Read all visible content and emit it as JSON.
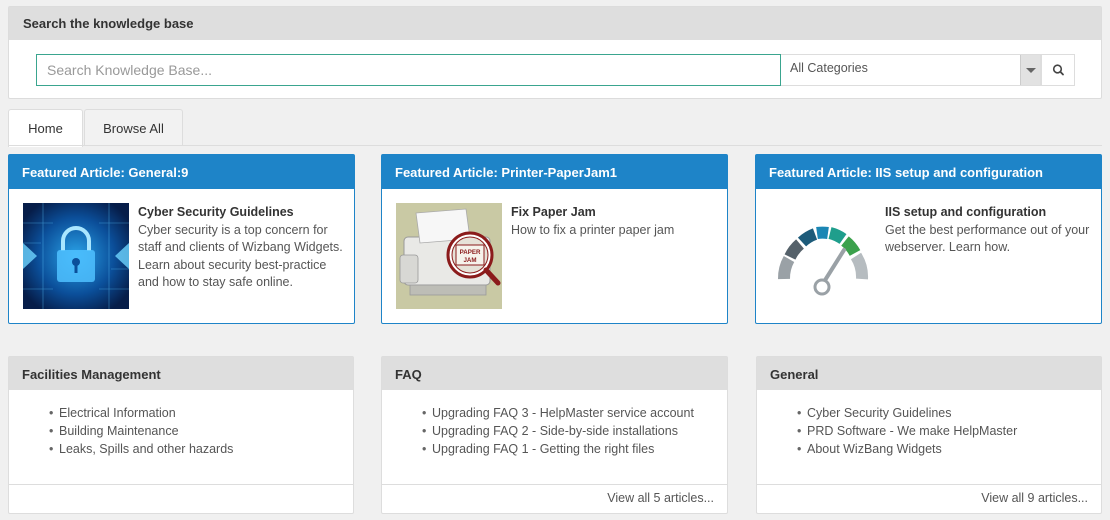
{
  "search": {
    "title": "Search the knowledge base",
    "placeholder": "Search Knowledge Base...",
    "category_selected": "All Categories",
    "search_icon": "search-icon"
  },
  "tabs": [
    {
      "label": "Home",
      "active": true
    },
    {
      "label": "Browse All",
      "active": false
    }
  ],
  "featured": [
    {
      "header": "Featured Article: General:9",
      "title": "Cyber Security Guidelines",
      "description": "Cyber security is a top concern for staff and clients of Wizbang Widgets. Learn about security best-practice and how to stay safe online.",
      "image": "padlock-circuit-image"
    },
    {
      "header": "Featured Article: Printer-PaperJam1",
      "title": "Fix Paper Jam",
      "description": "How to fix a printer paper jam",
      "image": "printer-paper-jam-image",
      "image_label": "PAPER JAM"
    },
    {
      "header": "Featured Article: IIS setup and configuration",
      "title": "IIS setup and configuration",
      "description": "Get the best performance out of your webserver. Learn how.",
      "image": "speedometer-gauge-image"
    }
  ],
  "categories": [
    {
      "title": "Facilities Management",
      "items": [
        "Electrical Information",
        "Building Maintenance",
        "Leaks, Spills and other hazards"
      ],
      "footer": ""
    },
    {
      "title": "FAQ",
      "items": [
        "Upgrading FAQ 3 - HelpMaster service account",
        "Upgrading FAQ 2 - Side-by-side installations",
        "Upgrading FAQ 1 - Getting the right files"
      ],
      "footer": "View all 5 articles..."
    },
    {
      "title": "General",
      "items": [
        "Cyber Security Guidelines",
        "PRD Software - We make HelpMaster",
        "About WizBang Widgets"
      ],
      "footer": "View all 9 articles..."
    }
  ],
  "colors": {
    "accent_blue": "#1e84c8",
    "header_grey": "#dedede",
    "search_focus": "#3aa58f"
  }
}
